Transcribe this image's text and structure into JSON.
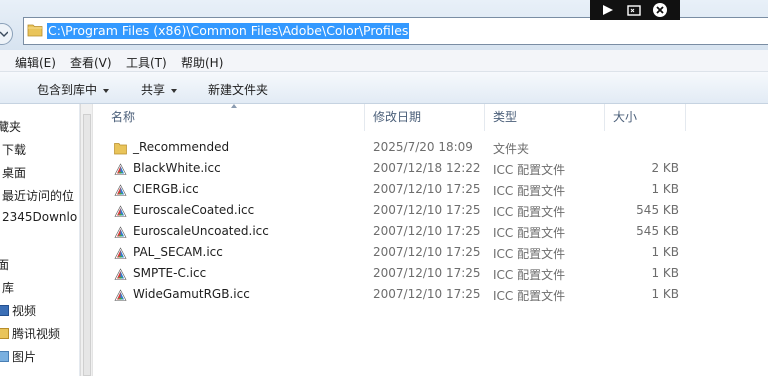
{
  "address_bar": {
    "path": "C:\\Program Files (x86)\\Common Files\\Adobe\\Color\\Profiles"
  },
  "menubar": {
    "items": [
      {
        "label": "编辑(E)"
      },
      {
        "label": "查看(V)"
      },
      {
        "label": "工具(T)"
      },
      {
        "label": "帮助(H)"
      }
    ]
  },
  "toolbar": {
    "include_label": "包含到库中",
    "share_label": "共享",
    "new_folder_label": "新建文件夹"
  },
  "nav_pane": {
    "items": [
      {
        "label": "藏夹"
      },
      {
        "label": "下载"
      },
      {
        "label": "桌面"
      },
      {
        "label": "最近访问的位"
      },
      {
        "label": "2345Downlo"
      },
      {
        "label": "面"
      },
      {
        "label": "库"
      },
      {
        "label": "视频"
      },
      {
        "label": "腾讯视频"
      },
      {
        "label": "图片"
      }
    ]
  },
  "columns": {
    "name": "名称",
    "date": "修改日期",
    "type": "类型",
    "size": "大小"
  },
  "files": [
    {
      "name": "_Recommended",
      "date": "2025/7/20 18:09",
      "type": "文件夹",
      "size": "",
      "icon": "folder-icon"
    },
    {
      "name": "BlackWhite.icc",
      "date": "2007/12/18 12:22",
      "type": "ICC 配置文件",
      "size": "2 KB",
      "icon": "icc-file-icon"
    },
    {
      "name": "CIERGB.icc",
      "date": "2007/12/10 17:25",
      "type": "ICC 配置文件",
      "size": "1 KB",
      "icon": "icc-file-icon"
    },
    {
      "name": "EuroscaleCoated.icc",
      "date": "2007/12/10 17:25",
      "type": "ICC 配置文件",
      "size": "545 KB",
      "icon": "icc-file-icon"
    },
    {
      "name": "EuroscaleUncoated.icc",
      "date": "2007/12/10 17:25",
      "type": "ICC 配置文件",
      "size": "545 KB",
      "icon": "icc-file-icon"
    },
    {
      "name": "PAL_SECAM.icc",
      "date": "2007/12/10 17:25",
      "type": "ICC 配置文件",
      "size": "1 KB",
      "icon": "icc-file-icon"
    },
    {
      "name": "SMPTE-C.icc",
      "date": "2007/12/10 17:25",
      "type": "ICC 配置文件",
      "size": "1 KB",
      "icon": "icc-file-icon"
    },
    {
      "name": "WideGamutRGB.icc",
      "date": "2007/12/10 17:25",
      "type": "ICC 配置文件",
      "size": "1 KB",
      "icon": "icc-file-icon"
    }
  ],
  "colors": {
    "selection": "#3399ff",
    "folder": "#e9c45a",
    "header_text": "#4c607a",
    "secondary_text": "#6d6d6d"
  }
}
